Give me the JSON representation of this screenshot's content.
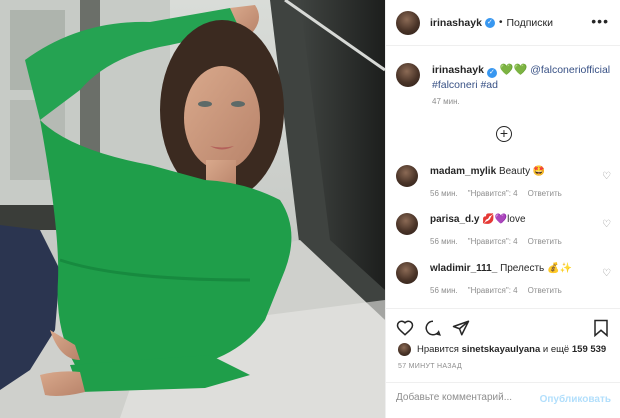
{
  "post": {
    "username": "irinashayk",
    "dot": "•",
    "follow_label": "Подписки",
    "more_icon": "ellipsis-icon"
  },
  "caption": {
    "username": "irinashayk",
    "emoji": "💚💚",
    "mention": "@falconeriofficial",
    "hashtags": "#falconeri #ad",
    "time": "47 мин."
  },
  "load_more_icon": "plus-circle-icon",
  "comments": [
    {
      "username": "madam_mylik",
      "text": "Beauty 🤩",
      "time": "56 мин.",
      "likes": "\"Нравится\": 4",
      "reply": "Ответить"
    },
    {
      "username": "parisa_d.y",
      "text": "💋💜love",
      "time": "56 мин.",
      "likes": "\"Нравится\": 4",
      "reply": "Ответить"
    },
    {
      "username": "wladimir_111_",
      "text": "Прелесть 💰✨",
      "time": "56 мин.",
      "likes": "\"Нравится\": 4",
      "reply": "Ответить"
    }
  ],
  "likes": {
    "prefix": "Нравится",
    "user": "sinetskayaulyana",
    "middle": "и ещё",
    "count": "159 539"
  },
  "timestamp": "57 МИНУТ НАЗАД",
  "comment_box": {
    "placeholder": "Добавьте комментарий...",
    "publish_label": "Опубликовать"
  },
  "colors": {
    "accent": "#3897f0",
    "publish_disabled": "#b2dffc",
    "sweater": "#1f9e4a",
    "text_muted": "#8e8e8e"
  }
}
